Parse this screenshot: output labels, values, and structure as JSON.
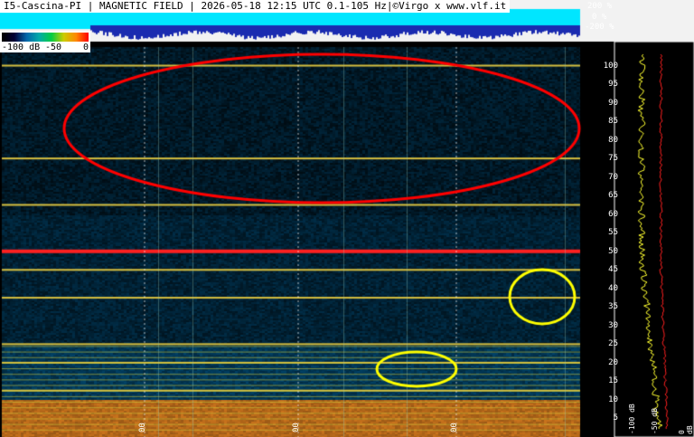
{
  "chart_data": {
    "type": "heatmap",
    "title": "I5-Cascina-PI | MAGNETIC FIELD | 2026-05-18 12:15 UTC 0.1-105 Hz|©Virgo x www.vlf.it",
    "scale": {
      "labels": [
        "-100 dB",
        "-50",
        "0"
      ]
    },
    "top_strip_labels": [
      "200 %",
      "0 %",
      "-200 %"
    ],
    "y_ticks": [
      100,
      95,
      90,
      85,
      80,
      75,
      70,
      65,
      60,
      55,
      50,
      45,
      40,
      35,
      30,
      25,
      20,
      15,
      10,
      5
    ],
    "x_ticks": [
      "00",
      "00",
      "00"
    ],
    "ylim": [
      0,
      105
    ],
    "horizontal_lines_hz": [
      50,
      62.5,
      75,
      100,
      25,
      20,
      12.5,
      37.5,
      45
    ],
    "spectrum_ticks": [
      "-100 dB",
      "-50 dB",
      "0 dB"
    ],
    "colors": {
      "red": "#ff2020",
      "yellow": "#ffff20",
      "cyan": "#00e6ff"
    }
  }
}
